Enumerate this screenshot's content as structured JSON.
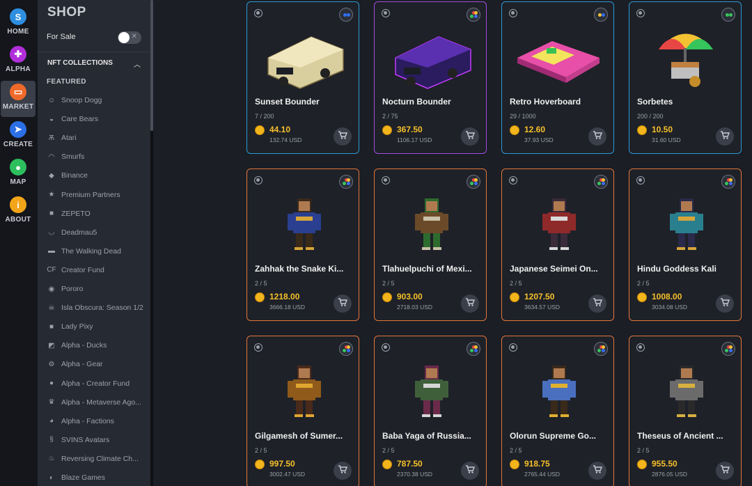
{
  "rail": [
    {
      "label": "HOME",
      "icon": "s",
      "color": "#2e8fe0"
    },
    {
      "label": "ALPHA",
      "icon": "controller-icon",
      "color": "#b12fd9"
    },
    {
      "label": "MARKET",
      "icon": "store-icon",
      "color": "#ef6a2a"
    },
    {
      "label": "CREATE",
      "icon": "rocket-icon",
      "color": "#2b6fe6"
    },
    {
      "label": "MAP",
      "icon": "pin-icon",
      "color": "#2dbf5e"
    },
    {
      "label": "ABOUT",
      "icon": "i",
      "color": "#f2a518"
    }
  ],
  "sidebar": {
    "title": "SHOP",
    "for_sale_label": "For Sale",
    "for_sale_on": false,
    "collections_header": "NFT COLLECTIONS",
    "featured_label": "FEATURED",
    "items": [
      {
        "label": "Snoop Dogg",
        "icon": "person-icon"
      },
      {
        "label": "Care Bears",
        "icon": "bear-icon"
      },
      {
        "label": "Atari",
        "icon": "atari-icon"
      },
      {
        "label": "Smurfs",
        "icon": "smurf-icon"
      },
      {
        "label": "Binance",
        "icon": "binance-icon"
      },
      {
        "label": "Premium Partners",
        "icon": "star-icon"
      },
      {
        "label": "ZEPETO",
        "icon": "square-icon"
      },
      {
        "label": "Deadmau5",
        "icon": "mouse-icon"
      },
      {
        "label": "The Walking Dead",
        "icon": "twd-icon"
      },
      {
        "label": "Creator Fund",
        "icon": "cf-icon"
      },
      {
        "label": "Pororo",
        "icon": "penguin-icon"
      },
      {
        "label": "Isla Obscura: Season 1/2",
        "icon": "skull-icon"
      },
      {
        "label": "Lady Pixy",
        "icon": "square-icon"
      },
      {
        "label": "Alpha - Ducks",
        "icon": "duck-icon"
      },
      {
        "label": "Alpha - Gear",
        "icon": "gear-icon"
      },
      {
        "label": "Alpha - Creator Fund",
        "icon": "head-icon"
      },
      {
        "label": "Alpha - Metaverse Ago...",
        "icon": "crown-icon"
      },
      {
        "label": "Alpha - Factions",
        "icon": "faction-icon"
      },
      {
        "label": "SVINS Avatars",
        "icon": "svins-icon"
      },
      {
        "label": "Reversing Climate Ch...",
        "icon": "flame-icon"
      },
      {
        "label": "Blaze Games",
        "icon": "blaze-icon"
      }
    ]
  },
  "cards": [
    {
      "name": "Sunset Bounder",
      "supply": "7 / 200",
      "price": "44.10",
      "usd": "132.74 USD",
      "border": "blue",
      "badge": "blue-dots",
      "art": "camper-beige"
    },
    {
      "name": "Nocturn Bounder",
      "supply": "2 / 75",
      "price": "367.50",
      "usd": "1106.17 USD",
      "border": "purple",
      "badge": "rgb-dots",
      "art": "camper-purple"
    },
    {
      "name": "Retro Hoverboard",
      "supply": "29 / 1000",
      "price": "12.60",
      "usd": "37.93 USD",
      "border": "blue",
      "badge": "yellow-blue-dots",
      "art": "hoverboard"
    },
    {
      "name": "Sorbetes",
      "supply": "200 / 200",
      "price": "10.50",
      "usd": "31.60 USD",
      "border": "blue",
      "badge": "green-dots",
      "art": "cart"
    },
    {
      "name": "Zahhak the Snake Ki...",
      "supply": "2 / 5",
      "price": "1218.00",
      "usd": "3666.18 USD",
      "border": "orange",
      "badge": "rgb-dots",
      "art": "hero-blue"
    },
    {
      "name": "Tlahuelpuchi of Mexi...",
      "supply": "2 / 5",
      "price": "903.00",
      "usd": "2718.03 USD",
      "border": "orange",
      "badge": "rgb-dots",
      "art": "hero-brown"
    },
    {
      "name": "Japanese Seimei On...",
      "supply": "2 / 5",
      "price": "1207.50",
      "usd": "3634.57 USD",
      "border": "orange",
      "badge": "rgb-dots",
      "art": "hero-red"
    },
    {
      "name": "Hindu Goddess Kali",
      "supply": "2 / 5",
      "price": "1008.00",
      "usd": "3034.08 USD",
      "border": "orange",
      "badge": "rgb-dots",
      "art": "hero-teal"
    },
    {
      "name": "Gilgamesh of Sumer...",
      "supply": "2 / 5",
      "price": "997.50",
      "usd": "3002.47 USD",
      "border": "orange",
      "badge": "rgb-dots",
      "art": "hero-gold"
    },
    {
      "name": "Baba Yaga of Russia...",
      "supply": "2 / 5",
      "price": "787.50",
      "usd": "2370.38 USD",
      "border": "orange",
      "badge": "rgb-dots",
      "art": "hero-green"
    },
    {
      "name": "Olorun Supreme Go...",
      "supply": "2 / 5",
      "price": "918.75",
      "usd": "2765.44 USD",
      "border": "orange",
      "badge": "rgb-dots",
      "art": "hero-bluegold"
    },
    {
      "name": "Theseus of Ancient ...",
      "supply": "2 / 5",
      "price": "955.50",
      "usd": "2876.05 USD",
      "border": "orange",
      "badge": "rgb-dots",
      "art": "hero-grey"
    }
  ]
}
